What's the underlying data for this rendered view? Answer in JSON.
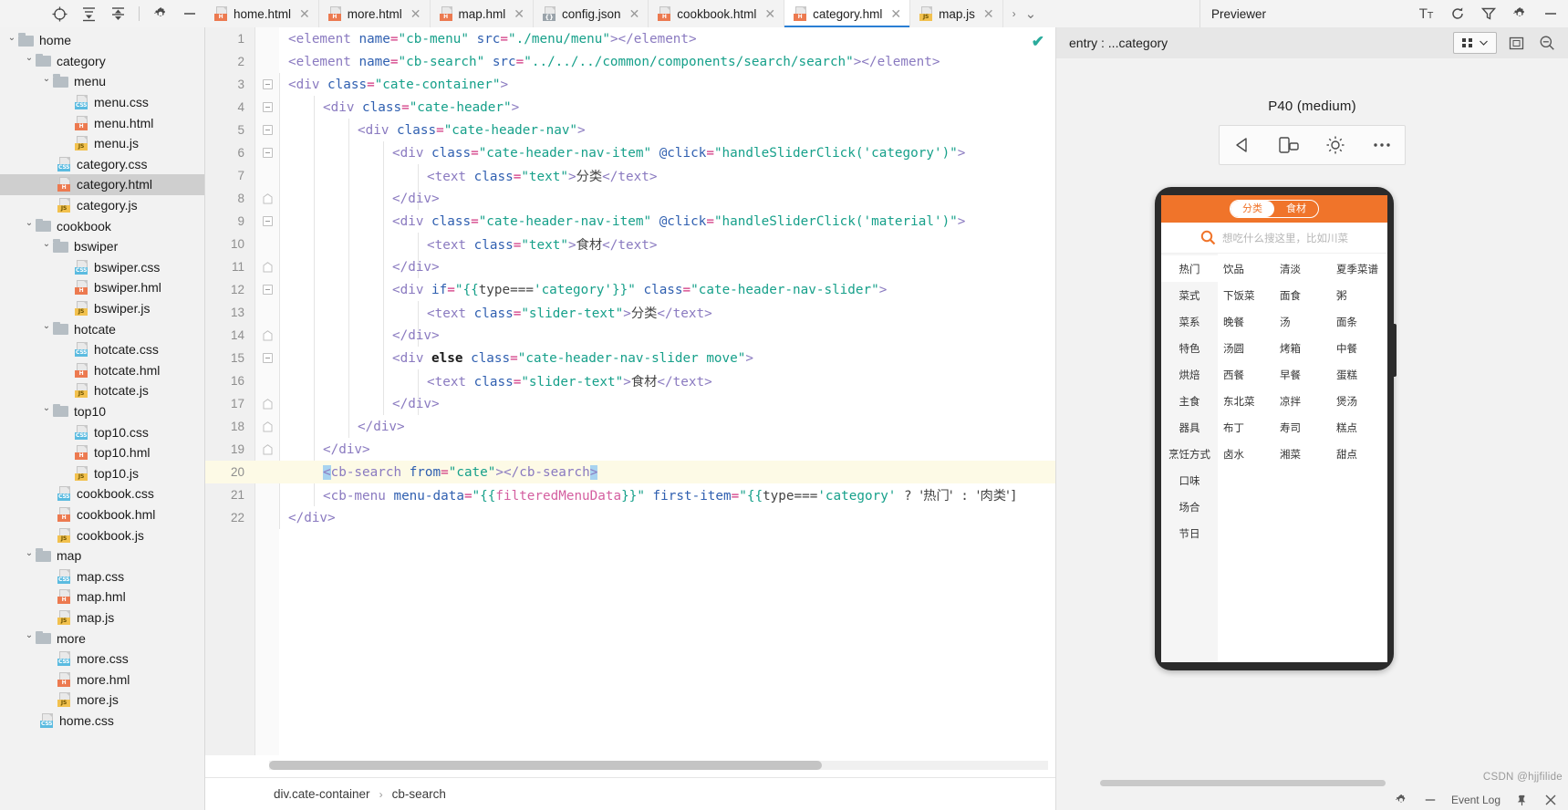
{
  "toolbar": {
    "icons": [
      {
        "name": "locate-icon",
        "glyph": "locate"
      },
      {
        "name": "collapse-all-icon",
        "glyph": "collapse"
      },
      {
        "name": "expand-all-icon",
        "glyph": "expand"
      },
      {
        "name": "settings-gear-icon",
        "glyph": "gear"
      },
      {
        "name": "minimize-icon",
        "glyph": "minus"
      }
    ]
  },
  "tabs": [
    {
      "label": "home.html",
      "type": "html",
      "active": false
    },
    {
      "label": "more.html",
      "type": "html",
      "active": false
    },
    {
      "label": "map.hml",
      "type": "html",
      "active": false
    },
    {
      "label": "config.json",
      "type": "json",
      "active": false
    },
    {
      "label": "cookbook.html",
      "type": "html",
      "active": false
    },
    {
      "label": "category.hml",
      "type": "html",
      "active": true
    },
    {
      "label": "map.js",
      "type": "js",
      "active": false
    }
  ],
  "tree": [
    {
      "depth": 0,
      "kind": "folder",
      "label": "home",
      "expanded": true,
      "selected": false
    },
    {
      "depth": 1,
      "kind": "folder",
      "label": "category",
      "expanded": true,
      "selected": false
    },
    {
      "depth": 2,
      "kind": "folder",
      "label": "menu",
      "expanded": true,
      "selected": false
    },
    {
      "depth": 4,
      "kind": "css",
      "label": "menu.css",
      "selected": false
    },
    {
      "depth": 4,
      "kind": "html",
      "label": "menu.html",
      "selected": false
    },
    {
      "depth": 4,
      "kind": "js",
      "label": "menu.js",
      "selected": false
    },
    {
      "depth": 3,
      "kind": "css",
      "label": "category.css",
      "selected": false
    },
    {
      "depth": 3,
      "kind": "html",
      "label": "category.html",
      "selected": true
    },
    {
      "depth": 3,
      "kind": "js",
      "label": "category.js",
      "selected": false
    },
    {
      "depth": 1,
      "kind": "folder",
      "label": "cookbook",
      "expanded": true,
      "selected": false
    },
    {
      "depth": 2,
      "kind": "folder",
      "label": "bswiper",
      "expanded": true,
      "selected": false
    },
    {
      "depth": 4,
      "kind": "css",
      "label": "bswiper.css",
      "selected": false
    },
    {
      "depth": 4,
      "kind": "html",
      "label": "bswiper.hml",
      "selected": false
    },
    {
      "depth": 4,
      "kind": "js",
      "label": "bswiper.js",
      "selected": false
    },
    {
      "depth": 2,
      "kind": "folder",
      "label": "hotcate",
      "expanded": true,
      "selected": false
    },
    {
      "depth": 4,
      "kind": "css",
      "label": "hotcate.css",
      "selected": false
    },
    {
      "depth": 4,
      "kind": "html",
      "label": "hotcate.hml",
      "selected": false
    },
    {
      "depth": 4,
      "kind": "js",
      "label": "hotcate.js",
      "selected": false
    },
    {
      "depth": 2,
      "kind": "folder",
      "label": "top10",
      "expanded": true,
      "selected": false
    },
    {
      "depth": 4,
      "kind": "css",
      "label": "top10.css",
      "selected": false
    },
    {
      "depth": 4,
      "kind": "html",
      "label": "top10.hml",
      "selected": false
    },
    {
      "depth": 4,
      "kind": "js",
      "label": "top10.js",
      "selected": false
    },
    {
      "depth": 3,
      "kind": "css",
      "label": "cookbook.css",
      "selected": false
    },
    {
      "depth": 3,
      "kind": "html",
      "label": "cookbook.hml",
      "selected": false
    },
    {
      "depth": 3,
      "kind": "js",
      "label": "cookbook.js",
      "selected": false
    },
    {
      "depth": 1,
      "kind": "folder",
      "label": "map",
      "expanded": true,
      "selected": false
    },
    {
      "depth": 3,
      "kind": "css",
      "label": "map.css",
      "selected": false
    },
    {
      "depth": 3,
      "kind": "html",
      "label": "map.hml",
      "selected": false
    },
    {
      "depth": 3,
      "kind": "js",
      "label": "map.js",
      "selected": false
    },
    {
      "depth": 1,
      "kind": "folder",
      "label": "more",
      "expanded": true,
      "selected": false
    },
    {
      "depth": 3,
      "kind": "css",
      "label": "more.css",
      "selected": false
    },
    {
      "depth": 3,
      "kind": "html",
      "label": "more.hml",
      "selected": false
    },
    {
      "depth": 3,
      "kind": "js",
      "label": "more.js",
      "selected": false
    },
    {
      "depth": 2,
      "kind": "css",
      "label": "home.css",
      "selected": false
    }
  ],
  "editor": {
    "lines": [
      {
        "n": 1,
        "fold": "none",
        "indent": 0,
        "tokens": [
          [
            "tag",
            "<element "
          ],
          [
            "attr",
            "name"
          ],
          [
            "eq",
            "="
          ],
          [
            "str",
            "\"cb-menu\""
          ],
          [
            "plain",
            " "
          ],
          [
            "attr",
            "src"
          ],
          [
            "eq",
            "="
          ],
          [
            "str",
            "\"./menu/menu\""
          ],
          [
            "tag",
            "></element>"
          ]
        ]
      },
      {
        "n": 2,
        "fold": "none",
        "indent": 0,
        "tokens": [
          [
            "tag",
            "<element "
          ],
          [
            "attr",
            "name"
          ],
          [
            "eq",
            "="
          ],
          [
            "str",
            "\"cb-search\""
          ],
          [
            "plain",
            " "
          ],
          [
            "attr",
            "src"
          ],
          [
            "eq",
            "="
          ],
          [
            "str",
            "\"../../../common/components/search/search\""
          ],
          [
            "tag",
            "></element>"
          ]
        ]
      },
      {
        "n": 3,
        "fold": "open",
        "indent": 0,
        "tokens": [
          [
            "tag",
            "<div "
          ],
          [
            "attr",
            "class"
          ],
          [
            "eq",
            "="
          ],
          [
            "str",
            "\"cate-container\""
          ],
          [
            "tag",
            ">"
          ]
        ]
      },
      {
        "n": 4,
        "fold": "open",
        "indent": 1,
        "tokens": [
          [
            "tag",
            "<div "
          ],
          [
            "attr",
            "class"
          ],
          [
            "eq",
            "="
          ],
          [
            "str",
            "\"cate-header\""
          ],
          [
            "tag",
            ">"
          ]
        ]
      },
      {
        "n": 5,
        "fold": "open",
        "indent": 2,
        "tokens": [
          [
            "tag",
            "<div "
          ],
          [
            "attr",
            "class"
          ],
          [
            "eq",
            "="
          ],
          [
            "str",
            "\"cate-header-nav\""
          ],
          [
            "tag",
            ">"
          ]
        ]
      },
      {
        "n": 6,
        "fold": "open",
        "indent": 3,
        "tokens": [
          [
            "tag",
            "<div "
          ],
          [
            "attr",
            "class"
          ],
          [
            "eq",
            "="
          ],
          [
            "str",
            "\"cate-header-nav-item\""
          ],
          [
            "plain",
            " "
          ],
          [
            "attr",
            "@click"
          ],
          [
            "eq",
            "="
          ],
          [
            "str",
            "\"handleSliderClick('category')\""
          ],
          [
            "tag",
            ">"
          ]
        ]
      },
      {
        "n": 7,
        "fold": "none",
        "indent": 4,
        "tokens": [
          [
            "tag",
            "<text "
          ],
          [
            "attr",
            "class"
          ],
          [
            "eq",
            "="
          ],
          [
            "str",
            "\"text\""
          ],
          [
            "tag",
            ">"
          ],
          [
            "cn",
            "分类"
          ],
          [
            "tag",
            "</text>"
          ]
        ]
      },
      {
        "n": 8,
        "fold": "close",
        "indent": 3,
        "tokens": [
          [
            "tag",
            "</div>"
          ]
        ]
      },
      {
        "n": 9,
        "fold": "open",
        "indent": 3,
        "tokens": [
          [
            "tag",
            "<div "
          ],
          [
            "attr",
            "class"
          ],
          [
            "eq",
            "="
          ],
          [
            "str",
            "\"cate-header-nav-item\""
          ],
          [
            "plain",
            " "
          ],
          [
            "attr",
            "@click"
          ],
          [
            "eq",
            "="
          ],
          [
            "str",
            "\"handleSliderClick('material')\""
          ],
          [
            "tag",
            ">"
          ]
        ]
      },
      {
        "n": 10,
        "fold": "none",
        "indent": 4,
        "tokens": [
          [
            "tag",
            "<text "
          ],
          [
            "attr",
            "class"
          ],
          [
            "eq",
            "="
          ],
          [
            "str",
            "\"text\""
          ],
          [
            "tag",
            ">"
          ],
          [
            "cn",
            "食材"
          ],
          [
            "tag",
            "</text>"
          ]
        ]
      },
      {
        "n": 11,
        "fold": "close",
        "indent": 3,
        "tokens": [
          [
            "tag",
            "</div>"
          ]
        ]
      },
      {
        "n": 12,
        "fold": "open",
        "indent": 3,
        "tokens": [
          [
            "tag",
            "<div "
          ],
          [
            "attr",
            "if"
          ],
          [
            "eq",
            "="
          ],
          [
            "str",
            "\"{{"
          ],
          [
            "plain",
            "type==="
          ],
          [
            "str",
            "'category'"
          ],
          [
            "str",
            "}}\""
          ],
          [
            "plain",
            " "
          ],
          [
            "attr",
            "class"
          ],
          [
            "eq",
            "="
          ],
          [
            "str",
            "\"cate-header-nav-slider\""
          ],
          [
            "tag",
            ">"
          ]
        ]
      },
      {
        "n": 13,
        "fold": "none",
        "indent": 4,
        "tokens": [
          [
            "tag",
            "<text "
          ],
          [
            "attr",
            "class"
          ],
          [
            "eq",
            "="
          ],
          [
            "str",
            "\"slider-text\""
          ],
          [
            "tag",
            ">"
          ],
          [
            "cn",
            "分类"
          ],
          [
            "tag",
            "</text>"
          ]
        ]
      },
      {
        "n": 14,
        "fold": "close",
        "indent": 3,
        "tokens": [
          [
            "tag",
            "</div>"
          ]
        ]
      },
      {
        "n": 15,
        "fold": "open",
        "indent": 3,
        "tokens": [
          [
            "tag",
            "<div "
          ],
          [
            "kw",
            "else"
          ],
          [
            "plain",
            " "
          ],
          [
            "attr",
            "class"
          ],
          [
            "eq",
            "="
          ],
          [
            "str",
            "\"cate-header-nav-slider move\""
          ],
          [
            "tag",
            ">"
          ]
        ]
      },
      {
        "n": 16,
        "fold": "none",
        "indent": 4,
        "tokens": [
          [
            "tag",
            "<text "
          ],
          [
            "attr",
            "class"
          ],
          [
            "eq",
            "="
          ],
          [
            "str",
            "\"slider-text\""
          ],
          [
            "tag",
            ">"
          ],
          [
            "cn",
            "食材"
          ],
          [
            "tag",
            "</text>"
          ]
        ]
      },
      {
        "n": 17,
        "fold": "close",
        "indent": 3,
        "tokens": [
          [
            "tag",
            "</div>"
          ]
        ]
      },
      {
        "n": 18,
        "fold": "close",
        "indent": 2,
        "tokens": [
          [
            "tag",
            "</div>"
          ]
        ]
      },
      {
        "n": 19,
        "fold": "close",
        "indent": 1,
        "tokens": [
          [
            "tag",
            "</div>"
          ]
        ]
      },
      {
        "n": 20,
        "fold": "none",
        "indent": 1,
        "highlight": true,
        "tokens": [
          [
            "selopen",
            "<"
          ],
          [
            "tag",
            "cb-search "
          ],
          [
            "attr",
            "from"
          ],
          [
            "eq",
            "="
          ],
          [
            "str",
            "\"cate\""
          ],
          [
            "tag",
            "></cb-search"
          ],
          [
            "selclose",
            ">"
          ]
        ]
      },
      {
        "n": 21,
        "fold": "none",
        "indent": 1,
        "tokens": [
          [
            "tag",
            "<cb-menu "
          ],
          [
            "attr",
            "menu-data"
          ],
          [
            "eq",
            "="
          ],
          [
            "str",
            "\"{{"
          ],
          [
            "brace",
            "filteredMenuData"
          ],
          [
            "str",
            "}}\""
          ],
          [
            "plain",
            " "
          ],
          [
            "attr",
            "first-item"
          ],
          [
            "eq",
            "="
          ],
          [
            "str",
            "\"{{"
          ],
          [
            "plain",
            "type==="
          ],
          [
            "str",
            "'category'"
          ],
          [
            "plain",
            " ? "
          ],
          [
            "cn",
            "'热门'"
          ],
          [
            "plain",
            " : "
          ],
          [
            "cn",
            "'肉类'"
          ],
          [
            "plain",
            "]"
          ]
        ]
      },
      {
        "n": 22,
        "fold": "none",
        "indent": 0,
        "tokens": [
          [
            "tag",
            "</div>"
          ]
        ]
      }
    ],
    "breadcrumb": [
      "div.cate-container",
      "cb-search"
    ],
    "status_check": "✔"
  },
  "previewer": {
    "title": "Previewer",
    "entry_label": "entry : ...category",
    "device_label": "P40 (medium)",
    "header_icons": [
      {
        "name": "text-size-icon"
      },
      {
        "name": "refresh-icon"
      },
      {
        "name": "filter-icon"
      },
      {
        "name": "settings-gear-icon"
      },
      {
        "name": "minimize-icon"
      }
    ],
    "entry_icons": [
      {
        "name": "multi-device-icon"
      },
      {
        "name": "chevron-down-icon"
      },
      {
        "name": "fit-screen-icon"
      },
      {
        "name": "zoom-out-icon"
      }
    ],
    "device_tools": [
      {
        "name": "rotate-left-icon"
      },
      {
        "name": "orientation-icon"
      },
      {
        "name": "brightness-icon"
      },
      {
        "name": "more-options-icon"
      }
    ],
    "bottom_bar": {
      "gear": "gear-icon",
      "minimize": "minus-icon",
      "event_log": "Event Log",
      "pin": "pin-icon",
      "close": "close-icon"
    },
    "watermark": "CSDN @hjjfilide"
  },
  "phone_preview": {
    "nav_tabs": [
      {
        "label": "分类",
        "active": true
      },
      {
        "label": "食材",
        "active": false
      }
    ],
    "search_placeholder": "想吃什么搜这里，比如川菜",
    "search_icon": "search-icon",
    "sidebar": [
      {
        "label": "热门",
        "active": true
      },
      {
        "label": "菜式",
        "active": false
      },
      {
        "label": "菜系",
        "active": false
      },
      {
        "label": "特色",
        "active": false
      },
      {
        "label": "烘焙",
        "active": false
      },
      {
        "label": "主食",
        "active": false
      },
      {
        "label": "器具",
        "active": false
      },
      {
        "label": "烹饪方式",
        "active": false
      },
      {
        "label": "口味",
        "active": false
      },
      {
        "label": "场合",
        "active": false
      },
      {
        "label": "节日",
        "active": false
      }
    ],
    "grid": [
      "饮品",
      "清淡",
      "夏季菜谱",
      "下饭菜",
      "面食",
      "粥",
      "晚餐",
      "汤",
      "面条",
      "汤圆",
      "烤箱",
      "中餐",
      "西餐",
      "早餐",
      "蛋糕",
      "东北菜",
      "凉拌",
      "煲汤",
      "布丁",
      "寿司",
      "糕点",
      "卤水",
      "湘菜",
      "甜点"
    ]
  }
}
